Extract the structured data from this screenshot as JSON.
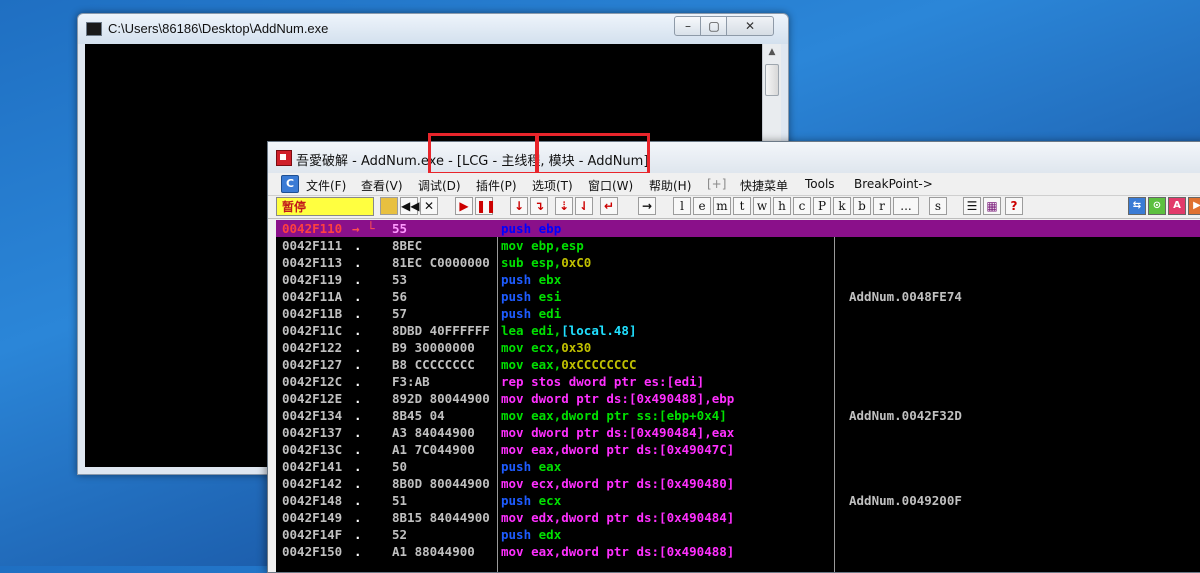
{
  "console": {
    "title": "C:\\Users\\86186\\Desktop\\AddNum.exe"
  },
  "debugger": {
    "title": "吾愛破解 - AddNum.exe - [LCG -  主线程, 模块 - AddNum]",
    "menu": [
      "文件(F)",
      "查看(V)",
      "调试(D)",
      "插件(P)",
      "选项(T)",
      "窗口(W)",
      "帮助(H)",
      "[+]",
      "快捷菜单",
      "Tools",
      "BreakPoint->"
    ],
    "status": "暂停",
    "letter_buttons": [
      "l",
      "e",
      "m",
      "t",
      "w",
      "h",
      "c",
      "P",
      "k",
      "b",
      "r",
      "...",
      "s"
    ],
    "highlight_color": "#e8252b"
  },
  "disasm": [
    {
      "addr": "0042F110",
      "mark": "",
      ".hex": "",
      "hex": "55",
      "mn": "push",
      "ops": "ebp",
      "color": "#0000ff",
      "opscolor": "#0000ff",
      "cmt": "",
      "sel": true
    },
    {
      "addr": "0042F111",
      "mark": ".",
      "hex": "8BEC",
      "mn": "mov",
      "ops": "ebp,esp",
      "color": "#00e000",
      "opscolor": "#00e000",
      "cmt": ""
    },
    {
      "addr": "0042F113",
      "mark": ".",
      "hex": "81EC C0000000",
      "mn": "sub",
      "ops": "esp,",
      "ops2": "0xC0",
      "color": "#00e000",
      "opscolor": "#00e000",
      "cmt": ""
    },
    {
      "addr": "0042F119",
      "mark": ".",
      "hex": "53",
      "mn": "push",
      "ops": "ebx",
      "color": "#1e5cff",
      "opscolor": "#00e000",
      "cmt": ""
    },
    {
      "addr": "0042F11A",
      "mark": ".",
      "hex": "56",
      "mn": "push",
      "ops": "esi",
      "color": "#1e5cff",
      "opscolor": "#00e000",
      "cmt": "AddNum.0048FE74"
    },
    {
      "addr": "0042F11B",
      "mark": ".",
      "hex": "57",
      "mn": "push",
      "ops": "edi",
      "color": "#1e5cff",
      "opscolor": "#00e000",
      "cmt": ""
    },
    {
      "addr": "0042F11C",
      "mark": ".",
      "hex": "8DBD 40FFFFFF",
      "mn": "lea",
      "ops": "edi,",
      "ops2": "[local.48]",
      "color": "#00e000",
      "opscolor": "#00e000",
      "cmt": ""
    },
    {
      "addr": "0042F122",
      "mark": ".",
      "hex": "B9 30000000",
      "mn": "mov",
      "ops": "ecx,",
      "ops2": "0x30",
      "color": "#00e000",
      "opscolor": "#00e000",
      "cmt": ""
    },
    {
      "addr": "0042F127",
      "mark": ".",
      "hex": "B8 CCCCCCCC",
      "mn": "mov",
      "ops": "eax,",
      "ops2": "0xCCCCCCCC",
      "color": "#00e000",
      "opscolor": "#00e000",
      "cmt": ""
    },
    {
      "addr": "0042F12C",
      "mark": ".",
      "hex": "F3:AB",
      "mn": "rep stos",
      "ops": "dword ptr es:[edi]",
      "color": "#ff30ff",
      "opscolor": "#ff30ff",
      "cmt": ""
    },
    {
      "addr": "0042F12E",
      "mark": ".",
      "hex": "892D 80044900",
      "mn": "mov",
      "ops": "dword ptr ds:[0x490488],ebp",
      "color": "#ff30ff",
      "opscolor": "#ff30ff",
      "cmt": ""
    },
    {
      "addr": "0042F134",
      "mark": ".",
      "hex": "8B45 04",
      "mn": "mov",
      "ops": "eax,dword ptr ss:[ebp+0x4]",
      "color": "#00e000",
      "opscolor": "#00e000",
      "cmt": "AddNum.0042F32D"
    },
    {
      "addr": "0042F137",
      "mark": ".",
      "hex": "A3 84044900",
      "mn": "mov",
      "ops": "dword ptr ds:[0x490484],eax",
      "color": "#ff30ff",
      "opscolor": "#ff30ff",
      "cmt": ""
    },
    {
      "addr": "0042F13C",
      "mark": ".",
      "hex": "A1 7C044900",
      "mn": "mov",
      "ops": "eax,dword ptr ds:[0x49047C]",
      "color": "#ff30ff",
      "opscolor": "#ff30ff",
      "cmt": ""
    },
    {
      "addr": "0042F141",
      "mark": ".",
      "hex": "50",
      "mn": "push",
      "ops": "eax",
      "color": "#1e5cff",
      "opscolor": "#00e000",
      "cmt": ""
    },
    {
      "addr": "0042F142",
      "mark": ".",
      "hex": "8B0D 80044900",
      "mn": "mov",
      "ops": "ecx,dword ptr ds:[0x490480]",
      "color": "#ff30ff",
      "opscolor": "#ff30ff",
      "cmt": ""
    },
    {
      "addr": "0042F148",
      "mark": ".",
      "hex": "51",
      "mn": "push",
      "ops": "ecx",
      "color": "#1e5cff",
      "opscolor": "#00e000",
      "cmt": "AddNum.0049200F"
    },
    {
      "addr": "0042F149",
      "mark": ".",
      "hex": "8B15 84044900",
      "mn": "mov",
      "ops": "edx,dword ptr ds:[0x490484]",
      "color": "#ff30ff",
      "opscolor": "#ff30ff",
      "cmt": ""
    },
    {
      "addr": "0042F14F",
      "mark": ".",
      "hex": "52",
      "mn": "push",
      "ops": "edx",
      "color": "#1e5cff",
      "opscolor": "#00e000",
      "cmt": ""
    },
    {
      "addr": "0042F150",
      "mark": ".",
      "hex": "A1 88044900",
      "mn": "mov",
      "ops": "eax,dword ptr ds:[0x490488]",
      "color": "#ff30ff",
      "opscolor": "#ff30ff",
      "cmt": ""
    }
  ]
}
